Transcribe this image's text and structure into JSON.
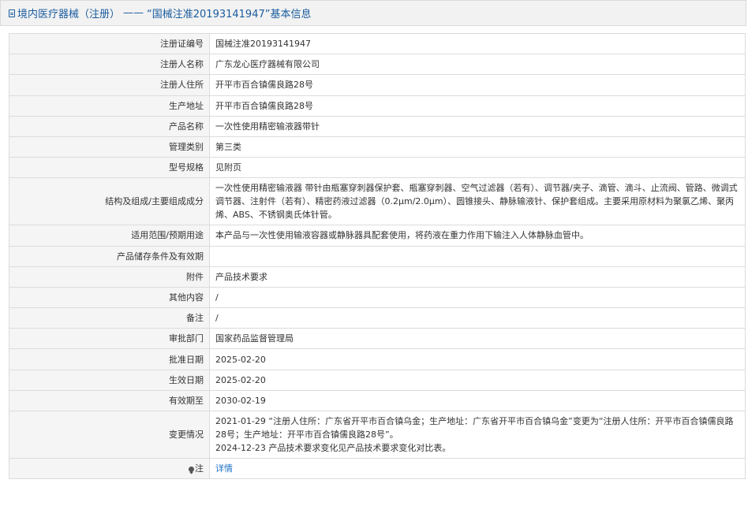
{
  "header": {
    "category": "境内医疗器械（注册）",
    "separator": "——",
    "record_title": "“国械注准20193141947”基本信息"
  },
  "rows": [
    {
      "label": "注册证编号",
      "value": "国械注准20193141947"
    },
    {
      "label": "注册人名称",
      "value": "广东龙心医疗器械有限公司"
    },
    {
      "label": "注册人住所",
      "value": "开平市百合镇儒良路28号"
    },
    {
      "label": "生产地址",
      "value": "开平市百合镇儒良路28号"
    },
    {
      "label": "产品名称",
      "value": "一次性使用精密输液器带针"
    },
    {
      "label": "管理类别",
      "value": "第三类"
    },
    {
      "label": "型号规格",
      "value": "见附页"
    },
    {
      "label": "结构及组成/主要组成成分",
      "value": "一次性使用精密输液器 带针由瓶塞穿刺器保护套、瓶塞穿刺器、空气过滤器（若有）、调节器/夹子、滴管、滴斗、止流阀、管路、微调式调节器、注射件（若有）、精密药液过滤器（0.2μm/2.0μm）、圆锥接头、静脉输液针、保护套组成。主要采用原材料为聚氯乙烯、聚丙烯、ABS、不锈钢奥氏体针管。"
    },
    {
      "label": "适用范围/预期用途",
      "value": "本产品与一次性使用输液容器或静脉器具配套使用，将药液在重力作用下输注入人体静脉血管中。"
    },
    {
      "label": "产品储存条件及有效期",
      "value": ""
    },
    {
      "label": "附件",
      "value": "产品技术要求"
    },
    {
      "label": "其他内容",
      "value": "/"
    },
    {
      "label": "备注",
      "value": "/"
    },
    {
      "label": "审批部门",
      "value": "国家药品监督管理局"
    },
    {
      "label": "批准日期",
      "value": "2025-02-20"
    },
    {
      "label": "生效日期",
      "value": "2025-02-20"
    },
    {
      "label": "有效期至",
      "value": "2030-02-19"
    }
  ],
  "changes": {
    "label": "变更情况",
    "entry1": "2021-01-29 “注册人住所：广东省开平市百合镇乌金；生产地址：广东省开平市百合镇乌金”变更为“注册人住所：开平市百合镇儒良路28号；生产地址：开平市百合镇儒良路28号”。",
    "entry2": "2024-12-23 产品技术要求变化见产品技术要求变化对比表。"
  },
  "note": {
    "label": "注",
    "link_text": "详情"
  },
  "colors": {
    "header_text": "#1a5c9e",
    "link": "#1a6fc4",
    "label_bg": "#f5f5f5",
    "border": "#dcdcdc"
  },
  "icons": {
    "header": "document-icon",
    "note": "pin-icon"
  }
}
